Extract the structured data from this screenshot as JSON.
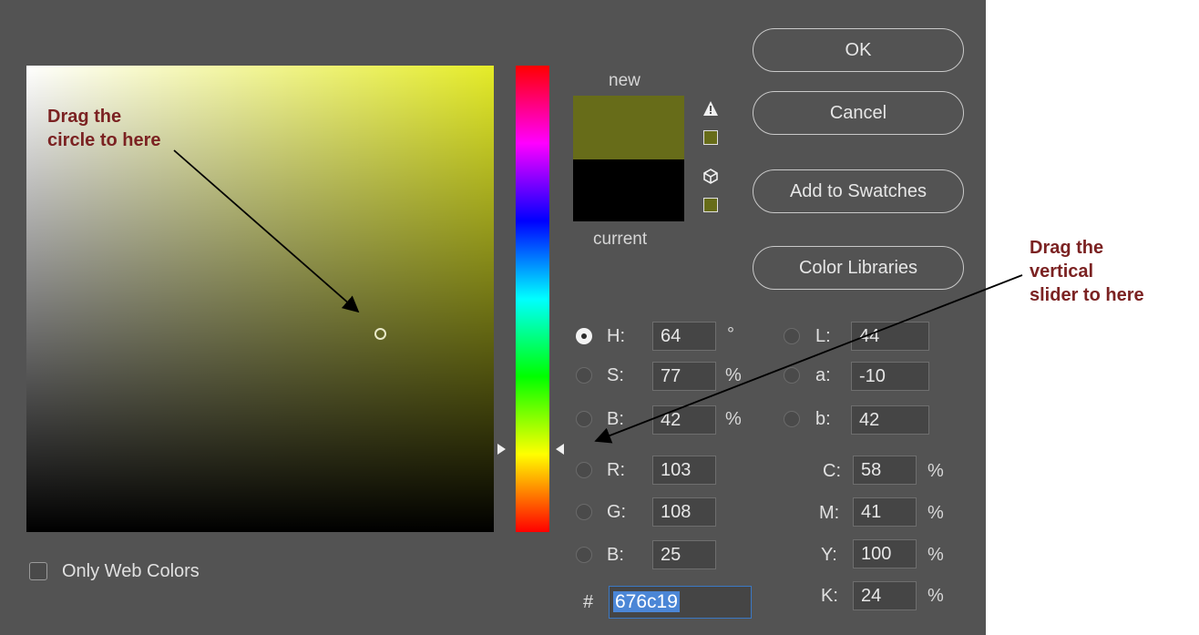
{
  "dialog": {
    "new_label": "new",
    "current_label": "current",
    "new_color": "#676c19",
    "current_color": "#000000"
  },
  "buttons": {
    "ok": "OK",
    "cancel": "Cancel",
    "add_swatches": "Add to Swatches",
    "color_libraries": "Color Libraries"
  },
  "hsb": {
    "h": {
      "label": "H:",
      "value": "64",
      "unit": "°"
    },
    "s": {
      "label": "S:",
      "value": "77",
      "unit": "%"
    },
    "b": {
      "label": "B:",
      "value": "42",
      "unit": "%"
    }
  },
  "rgb": {
    "r": {
      "label": "R:",
      "value": "103"
    },
    "g": {
      "label": "G:",
      "value": "108"
    },
    "b": {
      "label": "B:",
      "value": "25"
    }
  },
  "lab": {
    "l": {
      "label": "L:",
      "value": "44"
    },
    "a": {
      "label": "a:",
      "value": "-10"
    },
    "b": {
      "label": "b:",
      "value": "42"
    }
  },
  "cmyk": {
    "c": {
      "label": "C:",
      "value": "58",
      "unit": "%"
    },
    "m": {
      "label": "M:",
      "value": "41",
      "unit": "%"
    },
    "y": {
      "label": "Y:",
      "value": "100",
      "unit": "%"
    },
    "k": {
      "label": "K:",
      "value": "24",
      "unit": "%"
    }
  },
  "hex": {
    "label": "#",
    "value": "676c19"
  },
  "only_web_colors": "Only Web Colors",
  "annotations": {
    "left_line1": "Drag the",
    "left_line2": "circle to here",
    "right_line1": "Drag the",
    "right_line2": "vertical",
    "right_line3": "slider to here",
    "color": "#7b2222"
  },
  "icons": {
    "gamut_warning": "warning-triangle-icon",
    "web_safe": "cube-icon",
    "selected_mode": "H"
  }
}
